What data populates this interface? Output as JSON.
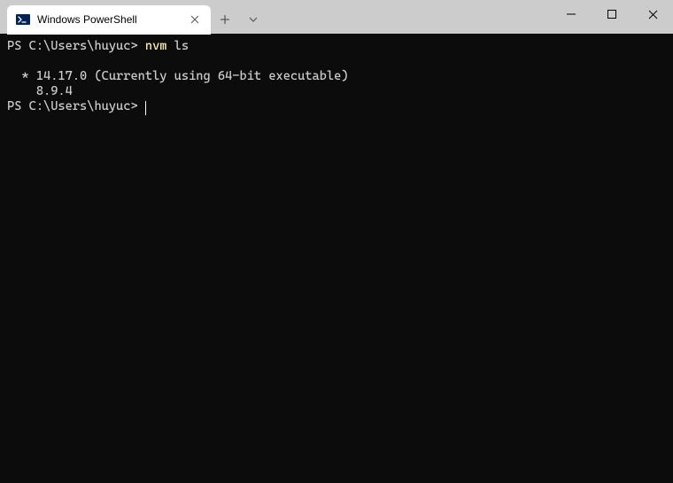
{
  "window": {
    "tab_title": "Windows PowerShell"
  },
  "terminal": {
    "prompt1": "PS C:\\Users\\huyuc> ",
    "cmd_highlight": "nvm",
    "cmd_arg": " ls",
    "output_line1": "  * 14.17.0 (Currently using 64-bit executable)",
    "output_line2": "    8.9.4",
    "prompt2": "PS C:\\Users\\huyuc> "
  }
}
